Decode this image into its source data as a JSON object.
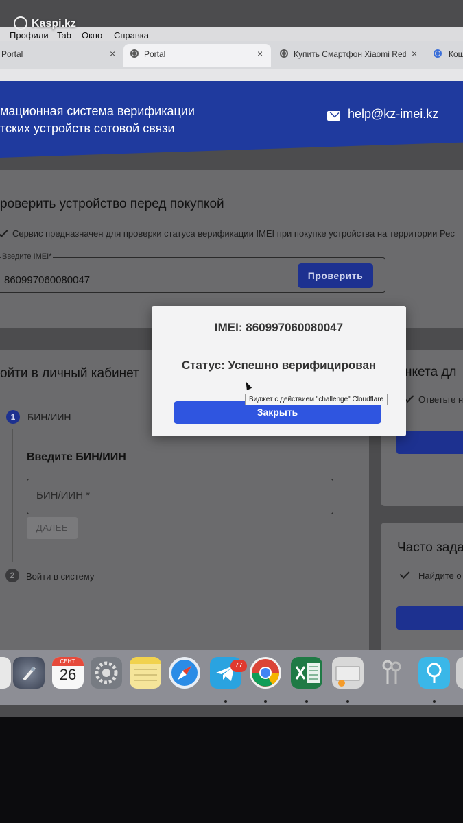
{
  "watermark": {
    "text": "Kaspi.kz",
    "icon": "kaspi-logo-icon"
  },
  "menubar": {
    "items": [
      "Профили",
      "Tab",
      "Окно",
      "Справка"
    ]
  },
  "tabs": [
    {
      "label": "Portal",
      "close": "×"
    },
    {
      "label": "Portal",
      "close": "×"
    },
    {
      "label": "Купить Смартфон Xiaomi Red",
      "close": "×"
    },
    {
      "label": "Кош"
    }
  ],
  "header": {
    "title_line1": "мационная система верификации",
    "title_line2": "тских устройств сотовой связи",
    "email": "help@kz-imei.kz",
    "email_icon": "envelope-icon"
  },
  "check": {
    "title": "роверить устройство перед покупкой",
    "description": "Сервис предназначен для проверки статуса верификации IMEI при покупке устройства на территории Рес",
    "imei_label": "Введите IMEI*",
    "imei_value": "860997060080047",
    "button": "Проверить"
  },
  "login": {
    "title": "ойти в личный кабинет",
    "step1_number": "1",
    "step1_label": "БИН/ИИН",
    "step1_heading": "Введите БИН/ИИН",
    "bin_placeholder": "БИН/ИИН *",
    "next_button": "ДАЛЕЕ",
    "step2_number": "2",
    "step2_label": "Войти в систему"
  },
  "right": {
    "card1_title": "нкета дл",
    "card1_text": "Ответьте н",
    "card2_title": "Часто зада",
    "card2_text": "Найдите о"
  },
  "modal": {
    "imei": "IMEI: 860997060080047",
    "status": "Статус: Успешно верифицирован",
    "close_button": "Закрыть"
  },
  "tooltip": "Виджет с действием \"challenge\" Cloudflare",
  "dock": {
    "calendar_month": "СЕНТ.",
    "calendar_day": "26",
    "telegram_badge": "77",
    "icons": [
      "launchpad-icon",
      "calendar-icon",
      "system-preferences-icon",
      "notes-icon",
      "safari-icon",
      "telegram-icon",
      "chrome-icon",
      "excel-icon",
      "preview-icon",
      "keychain-icon",
      "location-icon"
    ]
  },
  "colors": {
    "header_blue": "#1f3a9e",
    "button_blue": "#2f55e0",
    "dimmed_bg": "#6b6b6d"
  }
}
